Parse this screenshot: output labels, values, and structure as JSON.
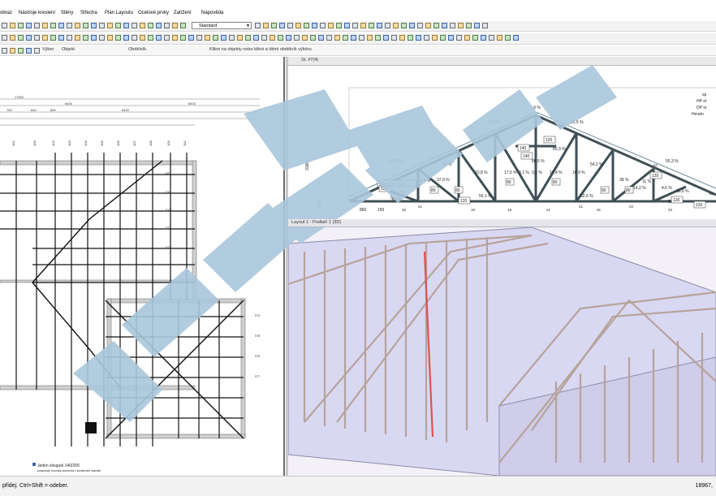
{
  "menu": {
    "items": [
      "obraz",
      "Nástroje kreslení",
      "Stěny",
      "Střecha",
      "Plán Layoutu",
      "Ocelové prvky",
      "Zatížení",
      "Nápověda"
    ]
  },
  "toolbar": {
    "style_combo": "Standard"
  },
  "selection_bar": {
    "label": "Výber",
    "object": "Objekt",
    "rect": "Obdélník",
    "hint": "Klikni na objekty nebo klikni a táhni obdélník výběru."
  },
  "left_plan": {
    "overall_dim": "17500",
    "dim_row1": [
      "6400",
      "5400"
    ],
    "dim_row2": [
      "750",
      "600",
      "850",
      "8400"
    ],
    "axis_labels": [
      "101",
      "100",
      "102",
      "103",
      "104",
      "105",
      "106",
      "107",
      "108",
      "109",
      "110"
    ],
    "right_labels": [
      "MS",
      "S70",
      "S71",
      "S72",
      "S73",
      "S74",
      "S75",
      "S76",
      "S77"
    ],
    "note_line1": "Jeden sloupek 140/200",
    "note_line2": "podporuje nosníky ukotvená v konstrukci vazníků"
  },
  "truss_view": {
    "tab_title": "St. #7(4)",
    "height_dims": [
      "3180",
      "593"
    ],
    "bottom_dims": [
      "860",
      "150"
    ],
    "right_legend": [
      "sp",
      "HP st",
      "DP st",
      "Hmotn"
    ],
    "percents": [
      "1,9 %",
      "21,5 %",
      "21,5 %",
      "55,3 %",
      "55,3 %",
      "54 %",
      "54,2 %",
      "37,9 %",
      "38 %",
      "17,5 %",
      "17,4 %",
      "11,4 %",
      "11 %",
      "10,8 %",
      "10,9 %",
      "14,3 %",
      "14,2 %",
      "4,6 %",
      "5,3 %",
      "3,1 %",
      "3,1 %",
      "80,3 %",
      "80,5 %",
      "59 %",
      "59 %",
      "55,1 %",
      "52,6 %",
      "36,6 %"
    ],
    "member_labels": [
      "140",
      "140",
      "120",
      "120",
      "120",
      "120",
      "80",
      "80",
      "80",
      "80",
      "80",
      "80",
      "120",
      "120"
    ],
    "section_label": "50x120 C24",
    "node_marks": [
      "s1",
      "s2",
      "s4",
      "s5",
      "21",
      "22",
      "23",
      "16",
      "18",
      "19",
      "13"
    ]
  },
  "model_view": {
    "tab_title": "Layout 1 - Podlaží 1 (3D)"
  },
  "status": {
    "left": "přidej. Ctrl+Shift = odeber.",
    "right": "18967,"
  },
  "colors": {
    "truss_wood": "#b6a39b",
    "roof_fill": "#d9d8f2",
    "roof_edge": "#8d8aa8",
    "watermark": "#a9c6dc",
    "highlight_red": "#e05050"
  }
}
